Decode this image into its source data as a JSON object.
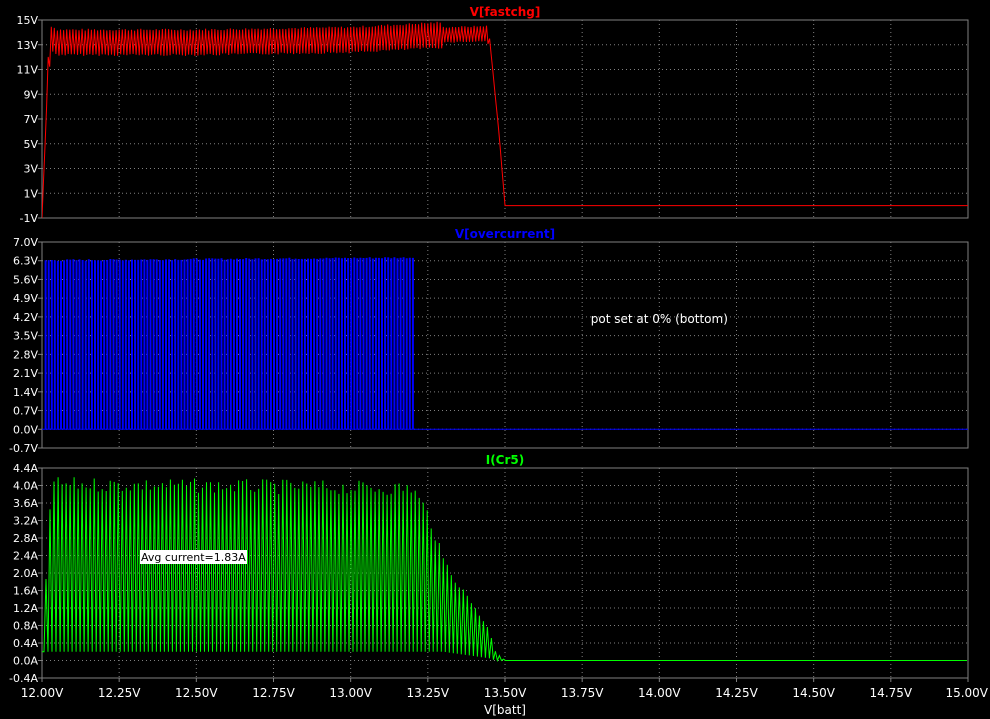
{
  "x_axis": {
    "label": "V[batt]",
    "ticks": [
      "12.00V",
      "12.25V",
      "12.50V",
      "12.75V",
      "13.00V",
      "13.25V",
      "13.50V",
      "13.75V",
      "14.00V",
      "14.25V",
      "14.50V",
      "14.75V",
      "15.00V"
    ],
    "range": [
      12.0,
      15.0
    ]
  },
  "chart_data": [
    {
      "type": "line",
      "title": "V[fastchg]",
      "color": "#ff0000",
      "ylim": [
        -1,
        15
      ],
      "yticks": [
        "15V",
        "13V",
        "11V",
        "9V",
        "7V",
        "5V",
        "3V",
        "1V",
        "-1V"
      ],
      "series": [
        {
          "name": "V[fastchg]",
          "x": [
            12.0,
            12.02,
            12.03,
            12.05,
            12.5,
            13.0,
            13.3,
            13.44,
            13.45,
            13.48,
            13.5,
            13.75,
            14.0,
            14.5,
            15.0
          ],
          "y": [
            -1.0,
            11.0,
            13.5,
            13.2,
            13.2,
            13.4,
            13.8,
            13.9,
            13.5,
            6.0,
            0.0,
            0.0,
            0.0,
            0.0,
            0.0
          ],
          "ripple_pp": 2.2
        }
      ]
    },
    {
      "type": "line",
      "title": "V[overcurrent]",
      "color": "#0000ff",
      "ylim": [
        -0.7,
        7.0
      ],
      "yticks": [
        "7.0V",
        "6.3V",
        "5.6V",
        "4.9V",
        "4.2V",
        "3.5V",
        "2.8V",
        "2.1V",
        "1.4V",
        "0.7V",
        "0.0V",
        "-0.7V"
      ],
      "annotation": "pot set at 0% (bottom)",
      "series": [
        {
          "name": "V[overcurrent]",
          "pulse_high_v": 6.3,
          "low_v": 0.0,
          "pulsing_until_x": 13.2,
          "x": [
            12.0,
            13.2,
            15.0
          ],
          "y": [
            6.3,
            6.4,
            0.0
          ]
        }
      ]
    },
    {
      "type": "line",
      "title": "I(Cr5)",
      "color": "#00ff00",
      "ylim": [
        -0.4,
        4.4
      ],
      "yticks": [
        "4.4A",
        "4.0A",
        "3.6A",
        "3.2A",
        "2.8A",
        "2.4A",
        "2.0A",
        "1.6A",
        "1.2A",
        "0.8A",
        "0.4A",
        "0.0A",
        "-0.4A"
      ],
      "annotation": "Avg current=1.83A",
      "series": [
        {
          "name": "I(Cr5)",
          "envelope_x": [
            12.0,
            12.03,
            13.2,
            13.25,
            13.3,
            13.35,
            13.4,
            13.45,
            13.47,
            13.5,
            15.0
          ],
          "envelope_max": [
            0.2,
            4.2,
            4.1,
            3.5,
            2.4,
            1.8,
            1.3,
            0.7,
            0.2,
            0.0,
            0.0
          ],
          "envelope_min": [
            0.2,
            0.2,
            0.2,
            0.2,
            0.2,
            0.15,
            0.1,
            0.05,
            0.0,
            0.0,
            0.0
          ]
        }
      ]
    }
  ]
}
